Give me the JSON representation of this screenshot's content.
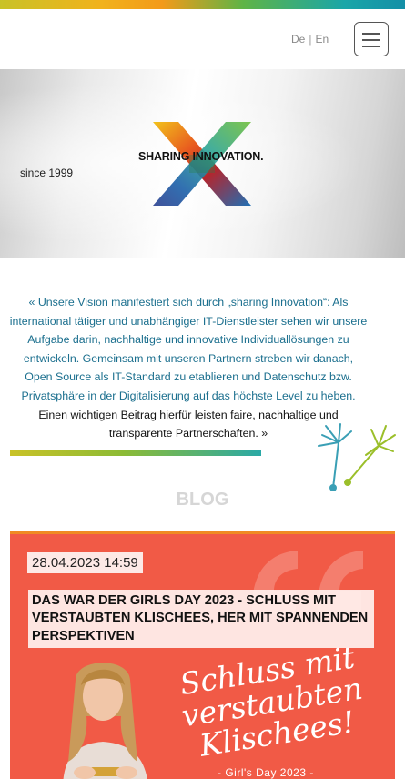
{
  "header": {
    "lang_de": "De",
    "lang_en": "En",
    "lang_separator": "|"
  },
  "hero": {
    "since": "since 1999",
    "tagline": "SHARING INNOVATION."
  },
  "vision": {
    "text_blue": "« Unsere Vision manifestiert sich durch „sharing Innovation“: Als international tätiger und unabhängiger IT-Dienstleister sehen wir unsere Aufgabe darin, nachhaltige und innovative Individuallösungen zu entwickeln. Gemeinsam mit unseren Partnern streben wir danach, Open Source als IT-Standard zu etablieren und Datenschutz bzw. Privatsphäre in der Digitalisierung auf das höchste Level zu heben.",
    "text_dark": "Einen wichtigen Beitrag hierfür leisten faire, nachhaltige und transparente Partnerschaften. »"
  },
  "blog": {
    "heading": "BLOG",
    "post": {
      "date": "28.04.2023 14:59",
      "title": "Das war der Girls Day 2023 - Schluss mit verstaubten Klischees, her mit spannenden Perspektiven",
      "image_text": "Schluss mit verstaubten Klischees!",
      "image_event": "- Girl's Day 2023 -"
    }
  },
  "colors": {
    "accent_blue": "#1b6f8e",
    "card_red": "#f15a46",
    "card_border": "#f08a24",
    "blog_heading": "#d6d6d6"
  },
  "icons": {
    "menu": "hamburger-menu-icon",
    "logo": "x-logo-icon",
    "dandelion": "dandelion-icon",
    "quote": "quote-mark-icon"
  }
}
